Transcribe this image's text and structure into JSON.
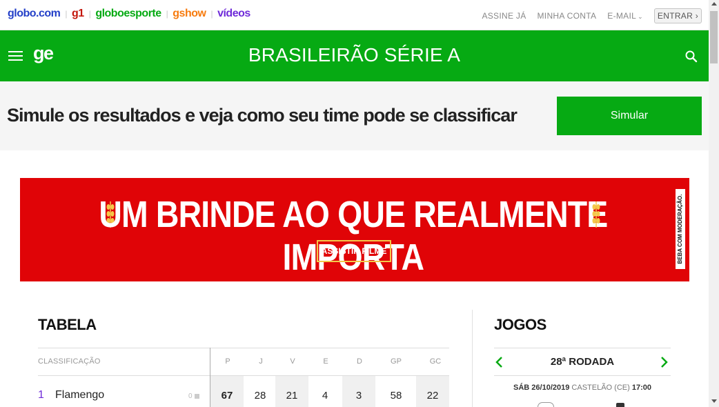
{
  "global_bar": {
    "links": [
      {
        "label": "globo.com",
        "color": "#2440c8"
      },
      {
        "label": "g1",
        "color": "#c4170c"
      },
      {
        "label": "globoesporte",
        "color": "#06aa13"
      },
      {
        "label": "gshow",
        "color": "#f77b0e"
      },
      {
        "label": "vídeos",
        "color": "#6f2bd9"
      }
    ],
    "right": {
      "assine": "ASSINE JÁ",
      "conta": "MINHA CONTA",
      "email": "E-MAIL",
      "entrar": "ENTRAR ›"
    }
  },
  "header": {
    "logo": "ge",
    "title": "BRASILEIRÃO SÉRIE A",
    "accent": "#06aa13"
  },
  "simulator": {
    "text": "Simule os resultados e veja como seu time pode se classificar",
    "button": "Simular"
  },
  "ad": {
    "headline": "UM BRINDE AO QUE REALMENTE IMPORTA",
    "cta": "ASSISTIR FILME",
    "disclaimer": "BEBA COM MODERAÇÃO.",
    "bg_color": "#e00407"
  },
  "tabela": {
    "title": "TABELA",
    "header_label": "CLASSIFICAÇÃO",
    "columns": [
      "P",
      "J",
      "V",
      "E",
      "D",
      "GP",
      "GC"
    ],
    "rows": [
      {
        "pos": "1",
        "team": "Flamengo",
        "variation": "0",
        "values": [
          "67",
          "28",
          "21",
          "4",
          "3",
          "58",
          "22"
        ]
      }
    ]
  },
  "jogos": {
    "title": "JOGOS",
    "round": "28ª RODADA",
    "match_date": "SÁB 26/10/2019",
    "match_venue": "CASTELÃO (CE)",
    "match_time": "17:00"
  }
}
